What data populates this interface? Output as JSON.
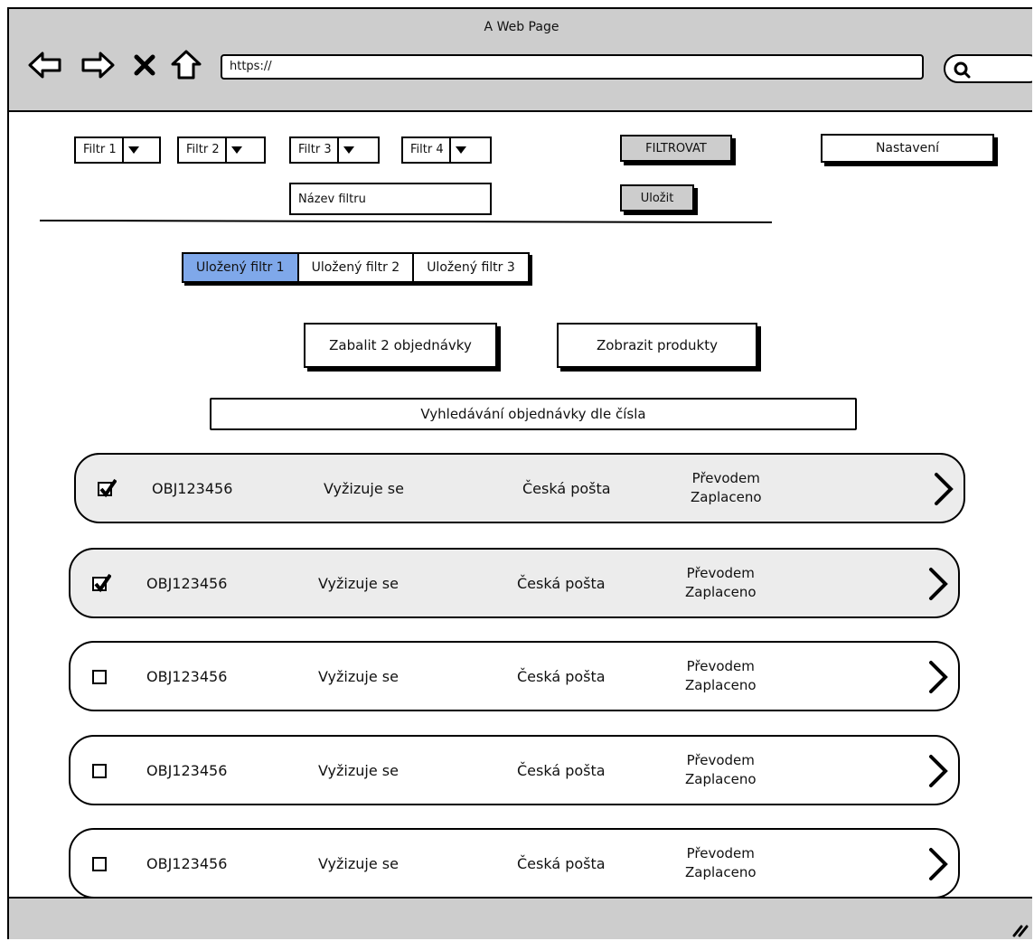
{
  "window": {
    "title": "A Web Page"
  },
  "browser": {
    "url": "https://",
    "back_icon": "back-arrow-icon",
    "forward_icon": "forward-arrow-icon",
    "close_icon": "close-icon",
    "home_icon": "home-icon",
    "search_icon": "search-icon"
  },
  "filters": {
    "selects": [
      {
        "label": "Filtr 1"
      },
      {
        "label": "Filtr 2"
      },
      {
        "label": "Filtr 3"
      },
      {
        "label": "Filtr 4"
      }
    ],
    "filter_button": "FILTROVAT",
    "settings_button": "Nastavení",
    "name_field_placeholder": "Název filtru",
    "save_button": "Uložit"
  },
  "saved_filters": {
    "tabs": [
      {
        "label": "Uložený filtr 1",
        "active": true
      },
      {
        "label": "Uložený filtr 2",
        "active": false
      },
      {
        "label": "Uložený filtr 3",
        "active": false
      }
    ]
  },
  "actions": {
    "pack_button": "Zabalit 2 objednávky",
    "products_button": "Zobrazit produkty"
  },
  "search": {
    "placeholder": "Vyhledávání objednávky dle čísla"
  },
  "orders": [
    {
      "checked": true,
      "id": "OBJ123456",
      "status": "Vyžizuje se",
      "carrier": "Česká pošta",
      "payment_method": "Převodem",
      "payment_status": "Zaplaceno"
    },
    {
      "checked": true,
      "id": "OBJ123456",
      "status": "Vyžizuje se",
      "carrier": "Česká pošta",
      "payment_method": "Převodem",
      "payment_status": "Zaplaceno"
    },
    {
      "checked": false,
      "id": "OBJ123456",
      "status": "Vyžizuje se",
      "carrier": "Česká pošta",
      "payment_method": "Převodem",
      "payment_status": "Zaplaceno"
    },
    {
      "checked": false,
      "id": "OBJ123456",
      "status": "Vyžizuje se",
      "carrier": "Česká pošta",
      "payment_method": "Převodem",
      "payment_status": "Zaplaceno"
    },
    {
      "checked": false,
      "id": "OBJ123456",
      "status": "Vyžizuje se",
      "carrier": "Česká pošta",
      "payment_method": "Převodem",
      "payment_status": "Zaplaceno"
    }
  ],
  "colors": {
    "chrome": "#cdcdcd",
    "active_tab": "#7fa8ea",
    "selected_row": "#ececec"
  }
}
